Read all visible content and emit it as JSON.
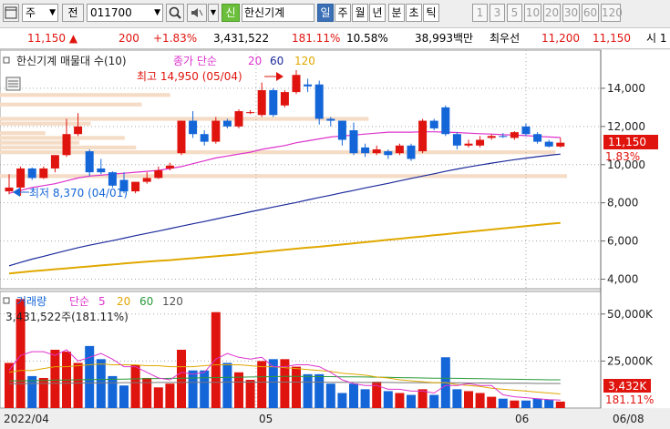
{
  "toolbar": {
    "view_icon": "chart-window-icon",
    "market_select": "주",
    "prefix_label": "전",
    "code_value": "011700",
    "search_icon": "magnifier-icon",
    "sound_icon": "speaker-icon",
    "badge": "신",
    "stock_name": "한신기계",
    "periods": [
      "일",
      "주",
      "월",
      "년",
      "분",
      "초",
      "틱"
    ],
    "active_period": "일",
    "intervals": [
      "1",
      "3",
      "5",
      "10",
      "20",
      "30",
      "60",
      "120"
    ]
  },
  "info": {
    "price": "11,150",
    "change": "200",
    "change_pct": "+1.83%",
    "volume": "3,431,522",
    "volume_ratio": "181.11%",
    "turnover": "10.58%",
    "amount": "38,993백만",
    "best_label": "최우선",
    "ask": "11,200",
    "bid": "11,150",
    "tail": "시 1"
  },
  "price_panel": {
    "legend_name": "한신기계 매물대 수(10)",
    "legend_ma": "종가 단순",
    "legend_ma_periods": [
      "20",
      "60",
      "120"
    ],
    "high_label": "최고 14,950 (05/04)",
    "low_label": "최저 8,370 (04/01)",
    "current_price": "11,150",
    "current_change": "1.83%"
  },
  "volume_panel": {
    "legend_name": "거래량",
    "legend_ma": "단순",
    "legend_ma_periods": [
      "5",
      "20",
      "60",
      "120"
    ],
    "summary": "3,431,522주(181.11%)",
    "current_volume": "3,432K",
    "current_ratio": "181.11%"
  },
  "x_axis": {
    "labels": [
      "2022/04",
      "05",
      "06",
      "06/08"
    ]
  },
  "colors": {
    "up": "#e0140e",
    "down": "#1466d8",
    "ma20": "#dd33cc",
    "ma60": "#1c2a9c",
    "ma120": "#e0a800",
    "volume_profile": "#f5dcc6",
    "grid": "#a8a8a8"
  },
  "chart_data": [
    {
      "type": "candlestick",
      "title": "한신기계 매물대 수(10)",
      "ylim": [
        3500,
        16000
      ],
      "yticks": [
        4000,
        6000,
        8000,
        10000,
        12000,
        14000
      ],
      "ytick_labels": [
        "4,000",
        "6,000",
        "8,000",
        "10,000",
        "12,000",
        "14,000"
      ],
      "candles": [
        {
          "o": 8600,
          "h": 9500,
          "l": 8450,
          "c": 8800
        },
        {
          "o": 8800,
          "h": 9900,
          "l": 8370,
          "c": 9800
        },
        {
          "o": 9800,
          "h": 9850,
          "l": 9200,
          "c": 9300
        },
        {
          "o": 9300,
          "h": 9900,
          "l": 9250,
          "c": 9800
        },
        {
          "o": 9800,
          "h": 10500,
          "l": 9600,
          "c": 10500
        },
        {
          "o": 10500,
          "h": 12400,
          "l": 10400,
          "c": 11600
        },
        {
          "o": 11600,
          "h": 12700,
          "l": 11500,
          "c": 12000
        },
        {
          "o": 10700,
          "h": 10800,
          "l": 9400,
          "c": 9600
        },
        {
          "o": 9800,
          "h": 10300,
          "l": 9500,
          "c": 9600
        },
        {
          "o": 9600,
          "h": 9650,
          "l": 8800,
          "c": 8900
        },
        {
          "o": 9200,
          "h": 9600,
          "l": 8500,
          "c": 8600
        },
        {
          "o": 8600,
          "h": 9100,
          "l": 8500,
          "c": 9100
        },
        {
          "o": 9100,
          "h": 9600,
          "l": 9000,
          "c": 9300
        },
        {
          "o": 9300,
          "h": 9900,
          "l": 9250,
          "c": 9700
        },
        {
          "o": 9800,
          "h": 10100,
          "l": 9700,
          "c": 9950
        },
        {
          "o": 10600,
          "h": 12300,
          "l": 10500,
          "c": 12300
        },
        {
          "o": 12300,
          "h": 12800,
          "l": 11400,
          "c": 11600
        },
        {
          "o": 11600,
          "h": 11800,
          "l": 11000,
          "c": 11200
        },
        {
          "o": 11200,
          "h": 12500,
          "l": 11100,
          "c": 12300
        },
        {
          "o": 12300,
          "h": 12400,
          "l": 11900,
          "c": 12000
        },
        {
          "o": 12000,
          "h": 12900,
          "l": 11900,
          "c": 12800
        },
        {
          "o": 12700,
          "h": 12850,
          "l": 12650,
          "c": 12750
        },
        {
          "o": 12600,
          "h": 14300,
          "l": 12500,
          "c": 13900
        },
        {
          "o": 13900,
          "h": 14000,
          "l": 12500,
          "c": 12600
        },
        {
          "o": 13100,
          "h": 13900,
          "l": 13000,
          "c": 13800
        },
        {
          "o": 13800,
          "h": 14950,
          "l": 13700,
          "c": 14700
        },
        {
          "o": 14200,
          "h": 14500,
          "l": 13800,
          "c": 14100
        },
        {
          "o": 14200,
          "h": 14400,
          "l": 12100,
          "c": 12400
        },
        {
          "o": 12400,
          "h": 12500,
          "l": 12000,
          "c": 12300
        },
        {
          "o": 12300,
          "h": 12300,
          "l": 11000,
          "c": 11300
        },
        {
          "o": 11800,
          "h": 12200,
          "l": 10500,
          "c": 10600
        },
        {
          "o": 10900,
          "h": 11100,
          "l": 10400,
          "c": 10600
        },
        {
          "o": 10600,
          "h": 11000,
          "l": 10500,
          "c": 10800
        },
        {
          "o": 10700,
          "h": 10800,
          "l": 10300,
          "c": 10500
        },
        {
          "o": 10600,
          "h": 11100,
          "l": 10500,
          "c": 11000
        },
        {
          "o": 11000,
          "h": 11100,
          "l": 10200,
          "c": 10300
        },
        {
          "o": 10700,
          "h": 12400,
          "l": 10600,
          "c": 12300
        },
        {
          "o": 12300,
          "h": 12400,
          "l": 11800,
          "c": 11900
        },
        {
          "o": 13000,
          "h": 13100,
          "l": 11500,
          "c": 11600
        },
        {
          "o": 11600,
          "h": 11700,
          "l": 10800,
          "c": 11000
        },
        {
          "o": 11000,
          "h": 11300,
          "l": 10900,
          "c": 11100
        },
        {
          "o": 11000,
          "h": 11500,
          "l": 10900,
          "c": 11300
        },
        {
          "o": 11400,
          "h": 11600,
          "l": 11300,
          "c": 11500
        },
        {
          "o": 11500,
          "h": 11650,
          "l": 11400,
          "c": 11450
        },
        {
          "o": 11400,
          "h": 11750,
          "l": 11300,
          "c": 11700
        },
        {
          "o": 12000,
          "h": 12150,
          "l": 11500,
          "c": 11600
        },
        {
          "o": 11600,
          "h": 11700,
          "l": 11100,
          "c": 11200
        },
        {
          "o": 11200,
          "h": 11300,
          "l": 10900,
          "c": 10950
        },
        {
          "o": 10950,
          "h": 11400,
          "l": 10900,
          "c": 11150
        }
      ],
      "ma20": [
        8500,
        8650,
        8800,
        8900,
        9000,
        9150,
        9300,
        9400,
        9450,
        9500,
        9550,
        9600,
        9650,
        9700,
        9800,
        9900,
        10050,
        10200,
        10350,
        10450,
        10550,
        10650,
        10800,
        10900,
        11000,
        11150,
        11250,
        11350,
        11450,
        11500,
        11550,
        11600,
        11650,
        11700,
        11700,
        11700,
        11720,
        11720,
        11700,
        11680,
        11650,
        11620,
        11600,
        11570,
        11550,
        11520,
        11480,
        11450,
        11420
      ],
      "ma60": [
        4700,
        4880,
        5050,
        5200,
        5350,
        5500,
        5650,
        5780,
        5900,
        6020,
        6150,
        6280,
        6400,
        6520,
        6650,
        6780,
        6900,
        7020,
        7150,
        7280,
        7400,
        7530,
        7650,
        7780,
        7900,
        8020,
        8150,
        8280,
        8400,
        8530,
        8650,
        8780,
        8900,
        9020,
        9150,
        9280,
        9400,
        9520,
        9650,
        9770,
        9880,
        9980,
        10080,
        10170,
        10260,
        10340,
        10420,
        10490,
        10550
      ],
      "ma120": [
        4300,
        4360,
        4420,
        4470,
        4520,
        4570,
        4620,
        4670,
        4720,
        4770,
        4820,
        4870,
        4920,
        4960,
        5000,
        5050,
        5100,
        5150,
        5200,
        5250,
        5300,
        5360,
        5420,
        5480,
        5540,
        5600,
        5650,
        5700,
        5760,
        5820,
        5880,
        5940,
        6000,
        6060,
        6120,
        6180,
        6240,
        6300,
        6360,
        6420,
        6480,
        6540,
        6600,
        6660,
        6720,
        6780,
        6840,
        6900,
        6950
      ],
      "volume_profile": [
        {
          "low": 9250,
          "high": 9500,
          "volume": 1.0
        },
        {
          "low": 10500,
          "high": 10750,
          "volume": 0.98
        },
        {
          "low": 10750,
          "high": 11000,
          "volume": 0.24
        },
        {
          "low": 11000,
          "high": 11250,
          "volume": 0.14
        },
        {
          "low": 11250,
          "high": 11500,
          "volume": 0.22
        },
        {
          "low": 11500,
          "high": 11750,
          "volume": 0.08
        },
        {
          "low": 12000,
          "high": 12250,
          "volume": 0.16
        },
        {
          "low": 12250,
          "high": 12500,
          "volume": 0.65
        },
        {
          "low": 13000,
          "high": 13250,
          "volume": 0.25
        },
        {
          "low": 13500,
          "high": 13750,
          "volume": 0.3
        }
      ]
    },
    {
      "type": "bar",
      "title": "거래량",
      "ylim": [
        0,
        62000
      ],
      "yticks": [
        25000,
        50000
      ],
      "ytick_labels": [
        "25,000K",
        "50,000K"
      ],
      "volumes": [
        24000,
        58000,
        17000,
        16000,
        31000,
        30000,
        24000,
        33000,
        26000,
        17000,
        12000,
        23000,
        16000,
        11000,
        13000,
        31000,
        20000,
        20000,
        51000,
        24000,
        19000,
        15000,
        25000,
        26000,
        26000,
        22000,
        18000,
        18000,
        13000,
        8000,
        13000,
        10000,
        14000,
        9000,
        8000,
        7000,
        10000,
        7000,
        27000,
        10000,
        9000,
        8000,
        6000,
        5000,
        4000,
        4000,
        5000,
        4500,
        3432
      ],
      "vma5": [
        20000,
        28000,
        30000,
        30000,
        28000,
        31000,
        25000,
        27000,
        29000,
        26000,
        22000,
        22000,
        19000,
        16000,
        15000,
        19000,
        18000,
        19000,
        26000,
        29000,
        27000,
        26000,
        27000,
        22000,
        22000,
        23000,
        23000,
        22000,
        19000,
        15000,
        13000,
        12000,
        12000,
        10000,
        10000,
        9000,
        9000,
        8000,
        12000,
        12000,
        13000,
        12000,
        12000,
        7000,
        6000,
        5500,
        5000,
        4500,
        4200
      ],
      "vma20": [
        19000,
        20000,
        20000,
        21000,
        22000,
        22000,
        22500,
        23000,
        23500,
        23000,
        23000,
        23000,
        22500,
        22500,
        22000,
        22000,
        22000,
        22500,
        23000,
        23000,
        23000,
        22500,
        22000,
        22000,
        21500,
        21000,
        20500,
        20000,
        19500,
        18500,
        18000,
        17500,
        16500,
        16000,
        15000,
        14500,
        14000,
        13500,
        13500,
        12500,
        12000,
        11500,
        10500,
        10000,
        9500,
        9000,
        8500,
        8000,
        7500
      ],
      "vma60": [
        14500,
        14500,
        14600,
        14700,
        14800,
        14900,
        15000,
        15100,
        15200,
        15300,
        15400,
        15500,
        15600,
        15700,
        15800,
        15900,
        16000,
        16100,
        16200,
        16300,
        16400,
        16500,
        16600,
        16700,
        16800,
        16800,
        16800,
        16700,
        16700,
        16600,
        16600,
        16500,
        16400,
        16300,
        16200,
        16100,
        16000,
        15900,
        15900,
        15800,
        15700,
        15600,
        15500,
        15400,
        15300,
        15200,
        15100,
        15000,
        15000
      ],
      "vma120": [
        13000,
        13000,
        13100,
        13100,
        13200,
        13200,
        13300,
        13300,
        13400,
        13400,
        13500,
        13500,
        13500,
        13600,
        13600,
        13600,
        13700,
        13700,
        13700,
        13800,
        13800,
        13800,
        13800,
        13800,
        13800,
        13800,
        13800,
        13800,
        13700,
        13700,
        13700,
        13600,
        13600,
        13600,
        13500,
        13500,
        13500,
        13400,
        13400,
        13400,
        13300,
        13300,
        13300,
        13200,
        13200,
        13200,
        13100,
        13100,
        13100
      ]
    }
  ]
}
